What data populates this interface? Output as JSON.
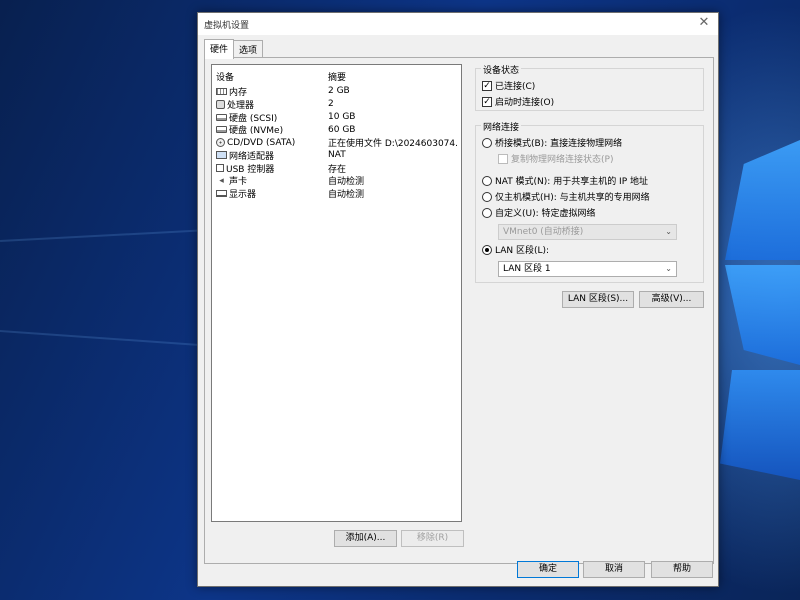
{
  "window": {
    "title": "虚拟机设置",
    "close_glyph": "✕"
  },
  "tabs": [
    {
      "label": "硬件"
    },
    {
      "label": "选项"
    }
  ],
  "device_list": {
    "headers": {
      "device": "设备",
      "summary": "摘要"
    },
    "rows": [
      {
        "icon": "memory-icon",
        "name": "内存",
        "summary": "2 GB"
      },
      {
        "icon": "processor-icon",
        "name": "处理器",
        "summary": "2"
      },
      {
        "icon": "hard-disk-icon",
        "name": "硬盘 (SCSI)",
        "summary": "10 GB"
      },
      {
        "icon": "hard-disk-icon",
        "name": "硬盘 (NVMe)",
        "summary": "60 GB"
      },
      {
        "icon": "cd-dvd-icon",
        "name": "CD/DVD (SATA)",
        "summary": "正在使用文件 D:\\2024603074..."
      },
      {
        "icon": "network-adapter-icon",
        "name": "网络适配器",
        "summary": "NAT"
      },
      {
        "icon": "usb-controller-icon",
        "name": "USB 控制器",
        "summary": "存在"
      },
      {
        "icon": "sound-card-icon",
        "name": "声卡",
        "summary": "自动检测"
      },
      {
        "icon": "display-icon",
        "name": "显示器",
        "summary": "自动检测"
      }
    ]
  },
  "device_buttons": {
    "add": "添加(A)...",
    "remove": "移除(R)"
  },
  "device_status": {
    "legend": "设备状态",
    "connected": {
      "label": "已连接(C)",
      "checked": true
    },
    "connect_at_power_on": {
      "label": "启动时连接(O)",
      "checked": true
    }
  },
  "network_connection": {
    "legend": "网络连接",
    "bridged": {
      "label": "桥接模式(B): 直接连接物理网络",
      "selected": false
    },
    "replicate": {
      "label": "复制物理网络连接状态(P)",
      "checked": false
    },
    "nat": {
      "label": "NAT 模式(N): 用于共享主机的 IP 地址",
      "selected": false
    },
    "host_only": {
      "label": "仅主机模式(H): 与主机共享的专用网络",
      "selected": false
    },
    "custom": {
      "label": "自定义(U): 特定虚拟网络",
      "selected": false
    },
    "custom_value": "VMnet0 (自动桥接)",
    "lan_segment": {
      "label": "LAN 区段(L):",
      "selected": true
    },
    "lan_segment_value": "LAN 区段 1"
  },
  "network_buttons": {
    "lan_segments": "LAN 区段(S)...",
    "advanced": "高级(V)..."
  },
  "footer": {
    "ok": "确定",
    "cancel": "取消",
    "help": "帮助"
  },
  "glyphs": {
    "check": "✓",
    "dropdown": "⌄"
  }
}
